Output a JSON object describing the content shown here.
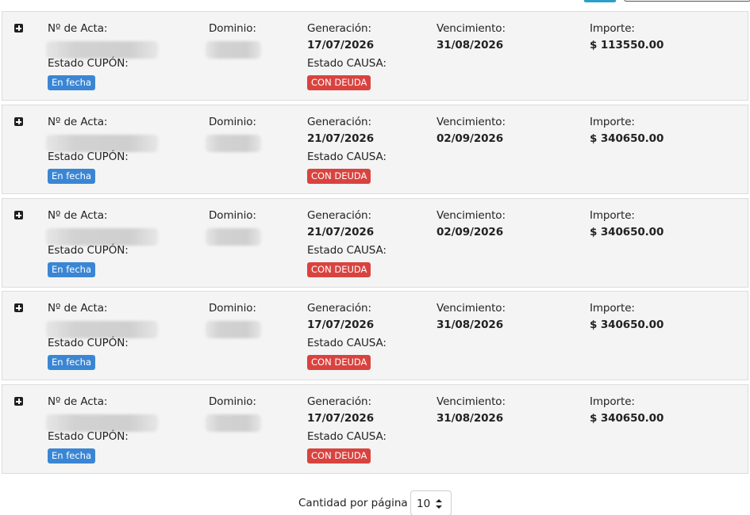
{
  "labels": {
    "acta": "Nº de Acta:",
    "dominio": "Dominio:",
    "generacion": "Generación:",
    "vencimiento": "Vencimiento:",
    "importe": "Importe:",
    "estado_cupon": "Estado CUPÓN:",
    "estado_causa": "Estado CAUSA:"
  },
  "records": [
    {
      "generacion": "17/07/2026",
      "vencimiento": "31/08/2026",
      "importe": "$ 113550.00",
      "estado_cupon": "En fecha",
      "estado_causa": "CON DEUDA"
    },
    {
      "generacion": "21/07/2026",
      "vencimiento": "02/09/2026",
      "importe": "$ 340650.00",
      "estado_cupon": "En fecha",
      "estado_causa": "CON DEUDA"
    },
    {
      "generacion": "21/07/2026",
      "vencimiento": "02/09/2026",
      "importe": "$ 340650.00",
      "estado_cupon": "En fecha",
      "estado_causa": "CON DEUDA"
    },
    {
      "generacion": "17/07/2026",
      "vencimiento": "31/08/2026",
      "importe": "$ 340650.00",
      "estado_cupon": "En fecha",
      "estado_causa": "CON DEUDA"
    },
    {
      "generacion": "17/07/2026",
      "vencimiento": "31/08/2026",
      "importe": "$ 340650.00",
      "estado_cupon": "En fecha",
      "estado_causa": "CON DEUDA"
    }
  ],
  "pagination": {
    "label": "Cantidad por página",
    "value": "10"
  },
  "icons": {
    "expand": "plus-square-icon",
    "select_arrows": "sort-arrows-icon"
  },
  "colors": {
    "badge_cupon": "#3a86d4",
    "badge_causa": "#d9433f",
    "card_bg": "#f4f4f4"
  }
}
